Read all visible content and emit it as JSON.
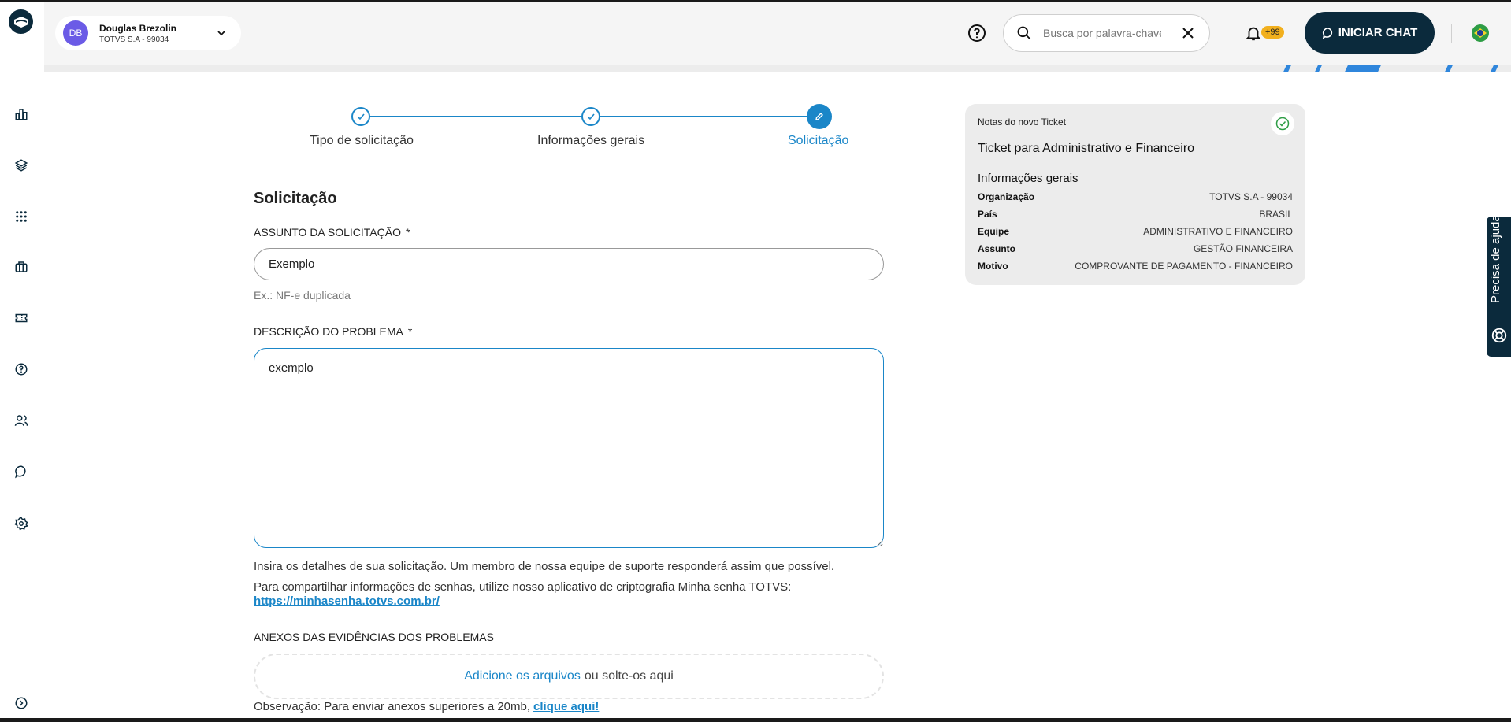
{
  "user": {
    "initials": "DB",
    "name": "Douglas Brezolin",
    "org": "TOTVS S.A - 99034"
  },
  "header": {
    "search_placeholder": "Busca por palavra-chave",
    "notifications_badge": "+99",
    "chat_label": "INICIAR CHAT"
  },
  "sidebar": {
    "icons": [
      "dashboard-icon",
      "layers-icon",
      "apps-grid-icon",
      "briefcase-icon",
      "ticket-icon",
      "help-icon",
      "users-icon",
      "chat-icon",
      "settings-icon",
      "expand-icon"
    ]
  },
  "stepper": {
    "steps": [
      {
        "label": "Tipo de solicitação",
        "state": "done"
      },
      {
        "label": "Informações gerais",
        "state": "done"
      },
      {
        "label": "Solicitação",
        "state": "active"
      }
    ]
  },
  "form": {
    "section_title": "Solicitação",
    "subject_label": "ASSUNTO DA SOLICITAÇÃO",
    "required_mark": "*",
    "subject_value": "Exemplo",
    "subject_hint": "Ex.: NF-e duplicada",
    "description_label": "DESCRIÇÃO DO PROBLEMA",
    "description_value": "exemplo",
    "info_line1": "Insira os detalhes de sua solicitação. Um membro de nossa equipe de suporte responderá assim que possível.",
    "info_line2": "Para compartilhar informações de senhas, utilize nosso aplicativo de criptografia Minha senha TOTVS:",
    "info_link": "https://minhasenha.totvs.com.br/",
    "attachments_label": "ANEXOS DAS EVIDÊNCIAS DOS PROBLEMAS",
    "dropzone_link": "Adicione os arquivos",
    "dropzone_rest": "ou solte-os aqui",
    "note_text": "Observação: Para enviar anexos superiores a 20mb,",
    "note_link": "clique aqui!"
  },
  "ticket_card": {
    "top_label": "Notas do novo Ticket",
    "title": "Ticket para Administrativo e Financeiro",
    "subtitle": "Informações gerais",
    "rows": [
      {
        "key": "Organização",
        "value": "TOTVS S.A - 99034"
      },
      {
        "key": "País",
        "value": "BRASIL"
      },
      {
        "key": "Equipe",
        "value": "ADMINISTRATIVO E FINANCEIRO"
      },
      {
        "key": "Assunto",
        "value": "GESTÃO FINANCEIRA"
      },
      {
        "key": "Motivo",
        "value": "COMPROVANTE DE PAGAMENTO - FINANCEIRO"
      }
    ]
  },
  "help_tab": {
    "label": "Precisa de ajuda?"
  },
  "colors": {
    "brand_dark": "#0b2a3c",
    "accent": "#1a86c8",
    "badge": "#f2b01e"
  }
}
